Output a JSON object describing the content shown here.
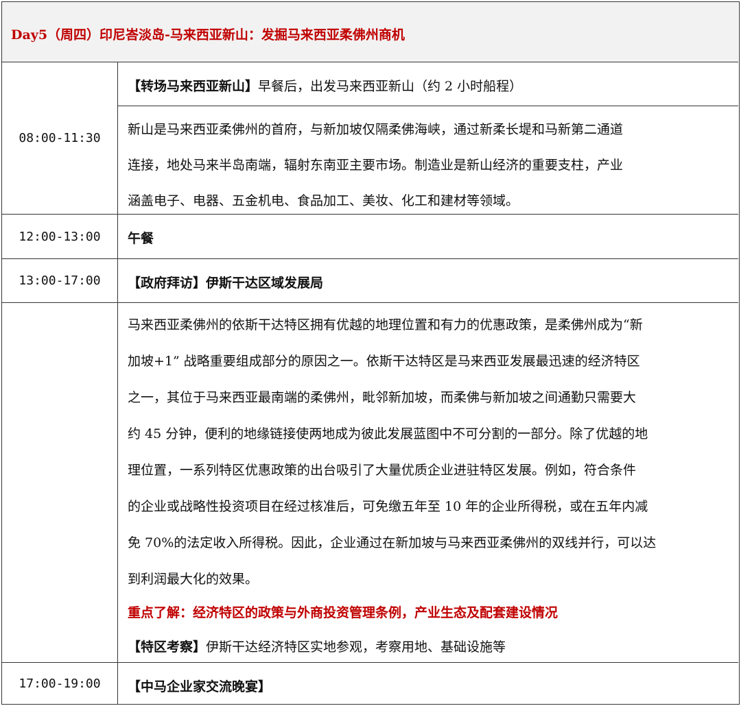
{
  "title": "Day5（周四）印尼峇淡岛-马来西亚新山：发掘马来西亚柔佛州商机",
  "rows": [
    {
      "time": "08:00-11:30",
      "intro_tag": "【转场马来西亚新山】",
      "intro_text": "早餐后，出发马来西亚新山（约 2 小时船程）",
      "desc_lines": [
        "新山是马来西亚柔佛州的首府，与新加坡仅隔柔佛海峡，通过新柔长堤和马新第二通道",
        "连接，地处马来半岛南端，辐射东南亚主要市场。制造业是新山经济的重要支柱，产业",
        "涵盖电子、电器、五金机电、食品加工、美妆、化工和建材等领域。"
      ]
    },
    {
      "time": "12:00-13:00",
      "text": "午餐"
    },
    {
      "time": "13:00-17:00",
      "tag": "【政府拜访】",
      "text": "伊斯干达区域发展局"
    },
    {
      "time": "",
      "para_lines": [
        "马来西亚柔佛州的依斯干达特区拥有优越的地理位置和有力的优惠政策，是柔佛州成为“新",
        "加坡+1” 战略重要组成部分的原因之一。依斯干达特区是马来西亚发展最迅速的经济特区",
        "之一，其位于马来西亚最南端的柔佛州，毗邻新加坡，而柔佛与新加坡之间通勤只需要大",
        "约 45 分钟，便利的地缘链接使两地成为彼此发展蓝图中不可分割的一部分。除了优越的地",
        "理位置，一系列特区优惠政策的出台吸引了大量优质企业进驻特区发展。例如，符合条件",
        "的企业或战略性投资项目在经过核准后，可免缴五年至 10 年的企业所得税，或在五年内减",
        "免 70%的法定收入所得税。因此，企业通过在新加坡与马来西亚柔佛州的双线并行，可以达",
        "到利润最大化的效果。"
      ],
      "highlight": "重点了解：经济特区的政策与外商投资管理条例，产业生态及配套建设情况",
      "visit_tag": "【特区考察】",
      "visit_text": "伊斯干达经济特区实地参观，考察用地、基础设施等"
    },
    {
      "time": "17:00-19:00",
      "text": "【中马企业家交流晚宴】"
    }
  ],
  "colors": {
    "title_red": "#c00000",
    "title_bg": "#f2f2f2",
    "border": "#333333"
  }
}
